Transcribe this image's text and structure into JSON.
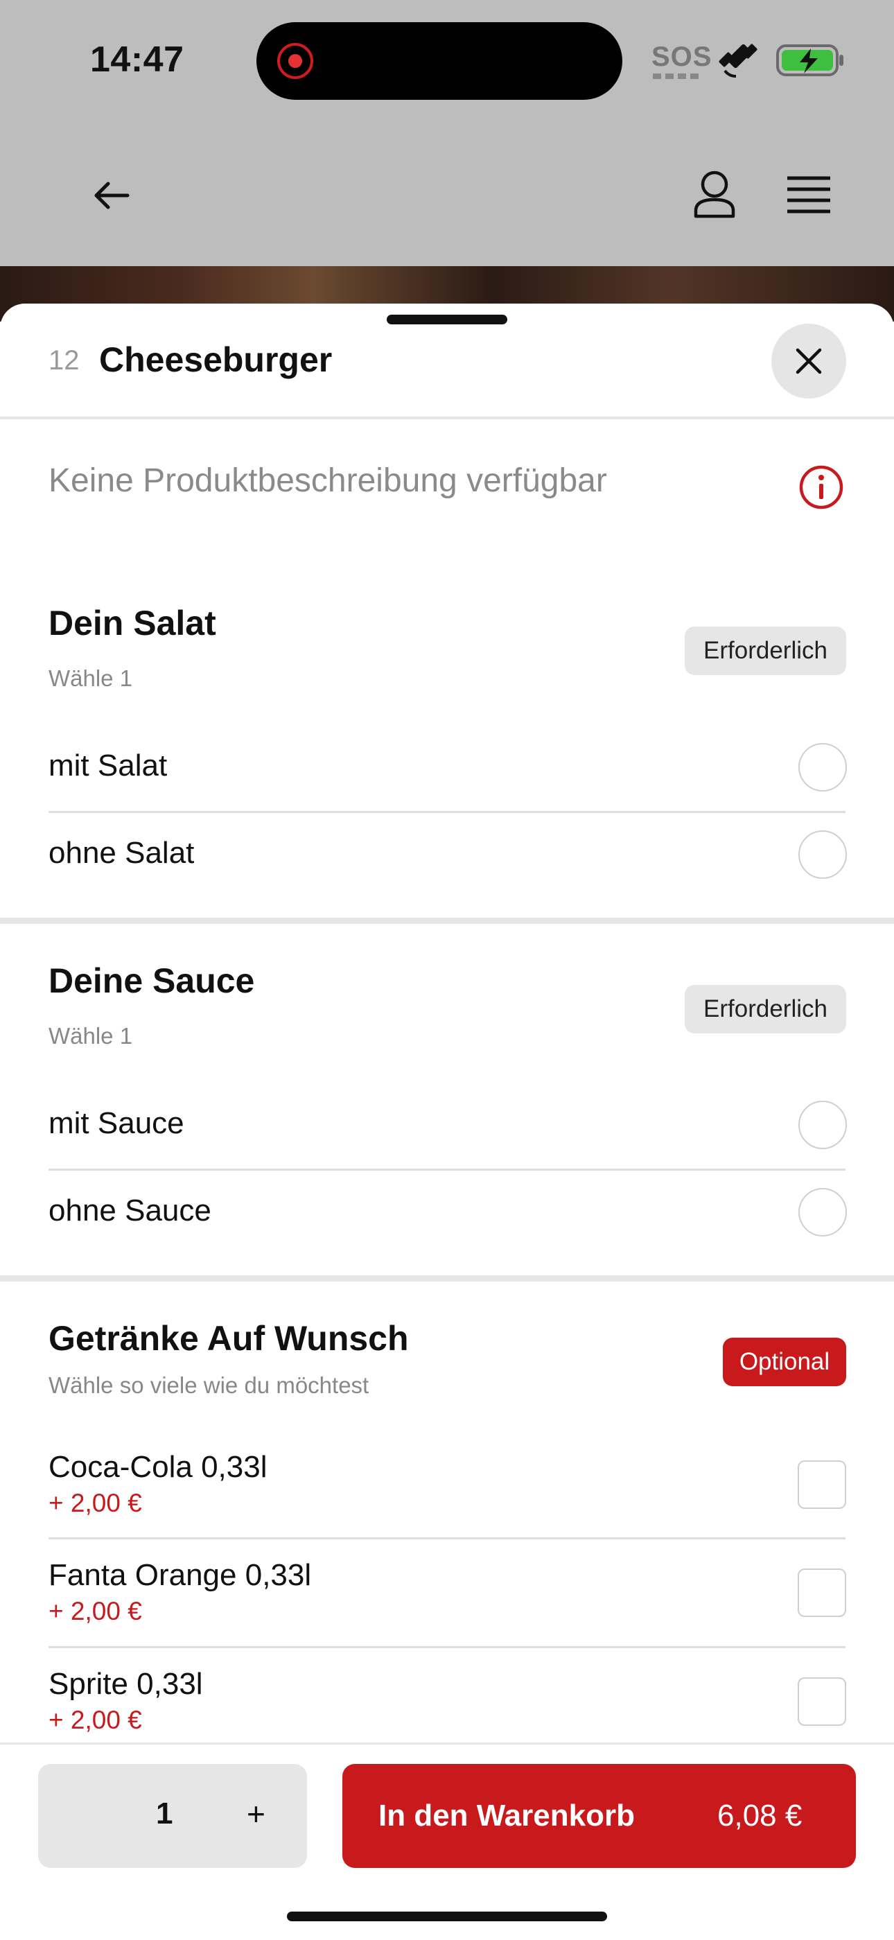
{
  "status_bar": {
    "time": "14:47",
    "sos": "SOS"
  },
  "header": {
    "back_icon": "arrow-left-icon",
    "account_icon": "person-icon",
    "menu_icon": "hamburger-menu-icon"
  },
  "product": {
    "number": "12",
    "name": "Cheeseburger",
    "description": "Keine Produktbeschreibung verfügbar"
  },
  "sections": [
    {
      "title": "Dein Salat",
      "subtitle": "Wähle 1",
      "badge": "Erforderlich",
      "options": [
        {
          "label": "mit Salat"
        },
        {
          "label": "ohne Salat"
        }
      ]
    },
    {
      "title": "Deine Sauce",
      "subtitle": "Wähle 1",
      "badge": "Erforderlich",
      "options": [
        {
          "label": "mit Sauce"
        },
        {
          "label": "ohne Sauce"
        }
      ]
    },
    {
      "title": "Getränke Auf Wunsch",
      "subtitle": "Wähle so viele wie du möchtest",
      "badge": "Optional",
      "options": [
        {
          "label": "Coca-Cola 0,33l",
          "price": "+ 2,00 €"
        },
        {
          "label": "Fanta Orange 0,33l",
          "price": "+ 2,00 €"
        },
        {
          "label": "Sprite 0,33l",
          "price": "+ 2,00 €"
        }
      ]
    }
  ],
  "footer": {
    "quantity": "1",
    "plus": "+",
    "cart_label": "In den Warenkorb",
    "cart_price": "6,08 €"
  },
  "colors": {
    "accent": "#c8191c",
    "header_bg": "#bdbdbd",
    "badge_gray": "#e6e6e6"
  }
}
